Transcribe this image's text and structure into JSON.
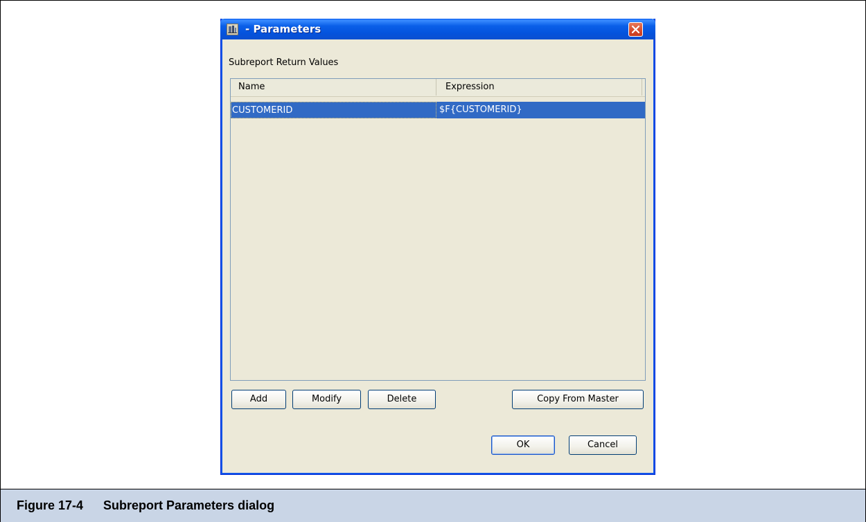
{
  "dialog": {
    "title": "- Parameters",
    "section_label": "Subreport Return Values",
    "table": {
      "columns": [
        "Name",
        "Expression"
      ],
      "rows": [
        {
          "name": "CUSTOMERID",
          "expression": "$F{CUSTOMERID}",
          "selected": true
        }
      ]
    },
    "buttons": {
      "add": "Add",
      "modify": "Modify",
      "delete": "Delete",
      "copy_from_master": "Copy From Master",
      "ok": "OK",
      "cancel": "Cancel"
    }
  },
  "caption": {
    "figure_number": "Figure 17-4",
    "text": "Subreport Parameters dialog"
  },
  "colors": {
    "titlebar": "#0453dd",
    "selection": "#316ac5",
    "caption_bg": "#c9d5e6",
    "dialog_bg": "#ece9d8"
  },
  "icons": [
    "app-icon",
    "close-icon"
  ]
}
